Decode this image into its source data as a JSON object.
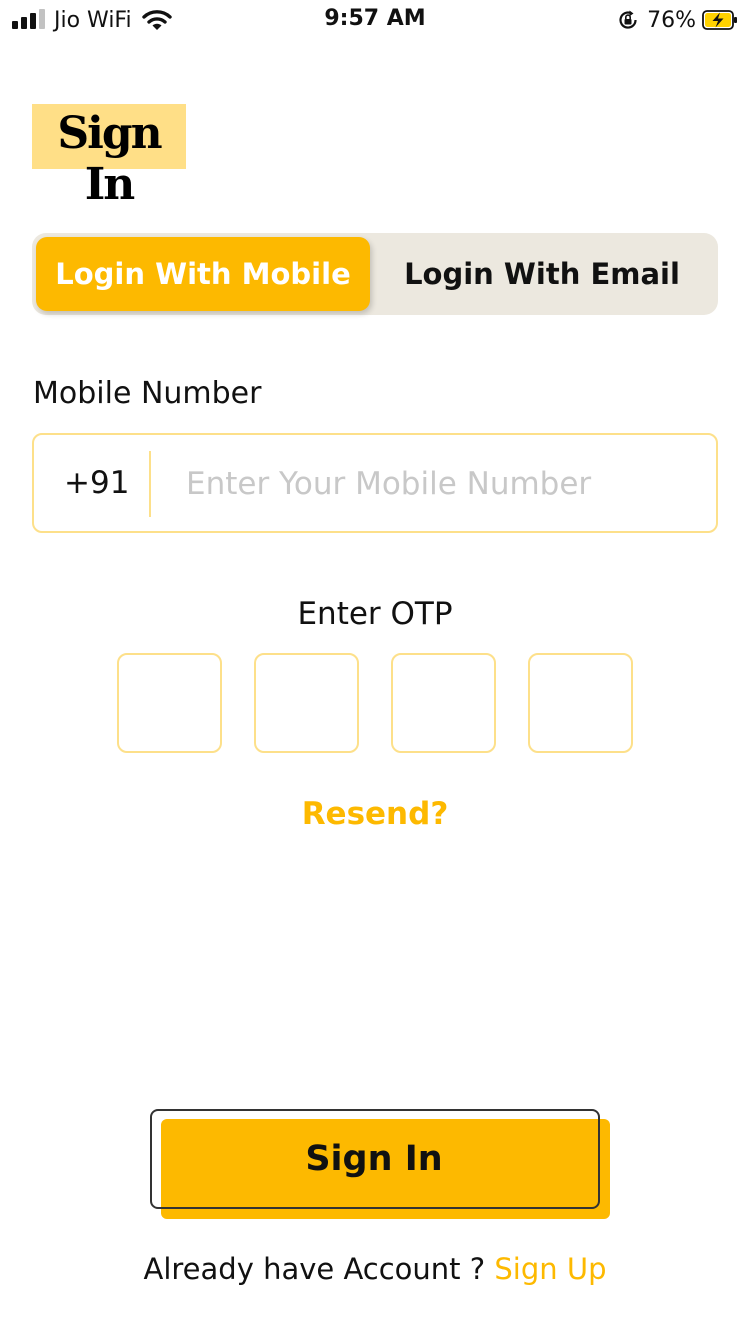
{
  "status_bar": {
    "carrier": "Jio WiFi",
    "time": "9:57 AM",
    "battery_percent": "76%",
    "signal_bars_filled": 3,
    "signal_bars_total": 4,
    "icons": [
      "signal-icon",
      "wifi-icon",
      "orientation-lock-icon",
      "battery-charging-icon"
    ]
  },
  "page": {
    "title": "Sign In"
  },
  "tabs": [
    {
      "label": "Login With Mobile",
      "active": true
    },
    {
      "label": "Login With Email",
      "active": false
    }
  ],
  "mobile": {
    "label": "Mobile Number",
    "country_code": "+91",
    "placeholder": "Enter Your Mobile Number",
    "value": ""
  },
  "otp": {
    "label": "Enter OTP",
    "digits": [
      "",
      "",
      "",
      ""
    ]
  },
  "resend_label": "Resend?",
  "signin_label": "Sign In",
  "footer": {
    "prompt": "Already have Account ?",
    "link": "Sign Up"
  },
  "colors": {
    "accent": "#fdb900",
    "title_highlight": "#ffdf87",
    "field_border": "#fde08a",
    "tab_background": "#ece8df"
  }
}
